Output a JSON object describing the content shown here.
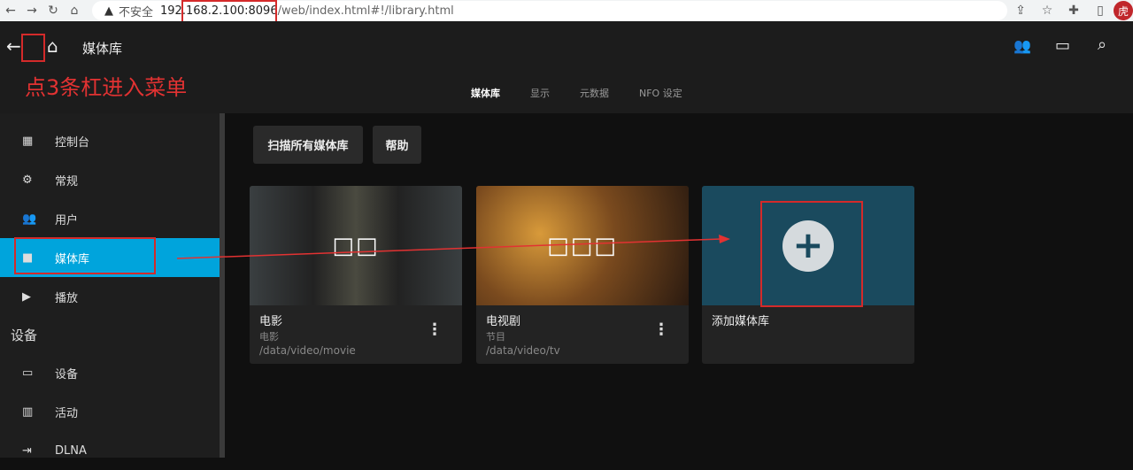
{
  "browser": {
    "insecure_label": "不安全",
    "url_host": "192.168.2.100:8096",
    "url_path": "/web/index.html#!/library.html",
    "avatar": "虎"
  },
  "header": {
    "title": "媒体库",
    "annotation": "点3条杠进入菜单"
  },
  "tabs": [
    {
      "label": "媒体库",
      "active": true
    },
    {
      "label": "显示"
    },
    {
      "label": "元数据"
    },
    {
      "label": "NFO 设定"
    }
  ],
  "sidebar": {
    "items": [
      {
        "label": "控制台",
        "icon": "dashboard-icon"
      },
      {
        "label": "常规",
        "icon": "gear-icon"
      },
      {
        "label": "用户",
        "icon": "users-icon"
      },
      {
        "label": "媒体库",
        "icon": "folder-icon",
        "active": true
      },
      {
        "label": "播放",
        "icon": "play-icon"
      }
    ],
    "section": "设备",
    "section_items": [
      {
        "label": "设备",
        "icon": "devices-icon"
      },
      {
        "label": "活动",
        "icon": "activity-icon"
      },
      {
        "label": "DLNA",
        "icon": "dlna-icon"
      }
    ]
  },
  "toolbar": {
    "scan_label": "扫描所有媒体库",
    "help_label": "帮助"
  },
  "libraries": [
    {
      "name": "电影",
      "type": "电影",
      "path": "/data/video/movie",
      "placeholder": "□□"
    },
    {
      "name": "电视剧",
      "type": "节目",
      "path": "/data/video/tv",
      "placeholder": "□□□"
    }
  ],
  "add_library": {
    "label": "添加媒体库"
  },
  "colors": {
    "accent": "#00a4dc",
    "annotation": "#e23232",
    "add_card": "#1a4a5e"
  }
}
